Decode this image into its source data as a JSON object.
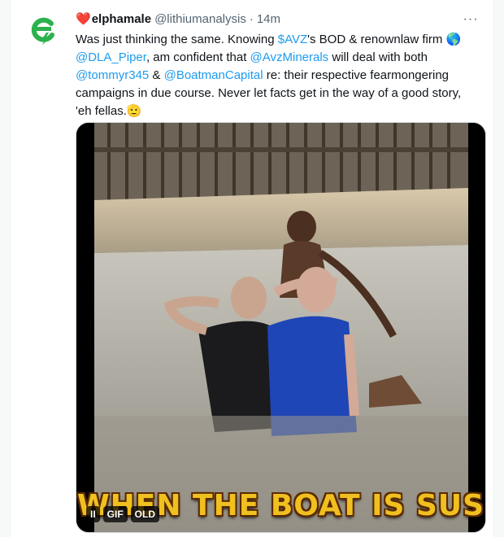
{
  "tweet": {
    "avatar_icon": "green-e-bolt-logo",
    "name_emoji": "❤️",
    "display_name": "elphamale",
    "handle": "@lithiumanalysis",
    "separator": "·",
    "timestamp": "14m",
    "more_icon": "···",
    "text": {
      "p1": "Was just thinking the same. Knowing ",
      "cashtag": "$AVZ",
      "p2": "'s BOD & renownlaw firm 🌎 ",
      "mention1": "@DLA_Piper",
      "p3": ", am confident that ",
      "mention2": "@AvzMinerals",
      "p4": " will deal with both ",
      "mention3": "@tommyr345",
      "p5": " & ",
      "mention4": "@BoatmanCapital",
      "p6": " re: their respective fearmongering campaigns in due course. Never let facts get in the way of a good story, 'eh fellas.🫡"
    },
    "media": {
      "caption": "WHEN THE BOAT IS SUS",
      "pause_label": "II",
      "gif_badge": "GIF",
      "alt_badge": "OLD"
    }
  },
  "colors": {
    "link": "#1d9bf0",
    "text": "#0f1419",
    "muted": "#536471",
    "heart": "#e0245e",
    "caption": "#f0c020"
  }
}
